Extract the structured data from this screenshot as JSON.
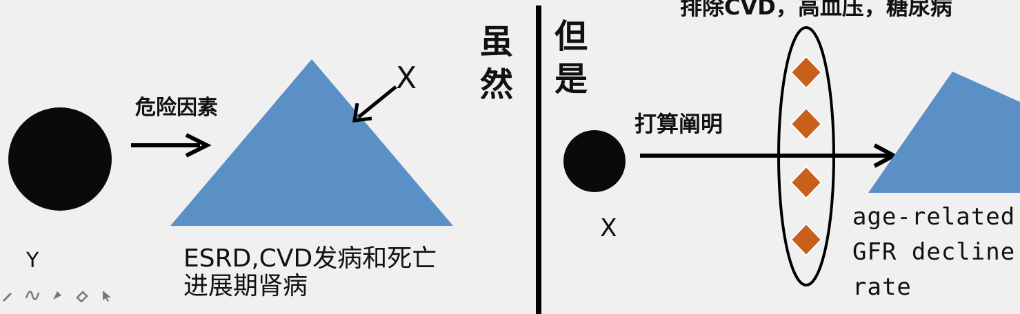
{
  "slide": {
    "title_fragment": "",
    "left_panel": {
      "circle_label": "Y",
      "arrow_label": "危险因素",
      "pointer_label": "X",
      "triangle_caption": [
        "ESRD,CVD发病和死亡",
        "进展期肾病"
      ]
    },
    "divider_words": {
      "left": [
        "虽",
        "然"
      ],
      "right": [
        "但",
        "是"
      ]
    },
    "right_panel": {
      "top_label": "排除CVD，高血压，糖尿病",
      "arrow_label": "打算阐明",
      "circle_label": "X",
      "triangle_caption": [
        "age-related",
        "GFR decline",
        "rate"
      ]
    }
  },
  "colors": {
    "background": "#f0f0f0",
    "circle": "#0a0a0a",
    "triangle": "#5b90c6",
    "diamond": "#c8601c",
    "title_red": "#e0201a"
  },
  "toolbar": {
    "icons": [
      "pen-icon",
      "curve-icon",
      "highlighter-icon",
      "eraser-icon",
      "pointer-icon"
    ]
  }
}
